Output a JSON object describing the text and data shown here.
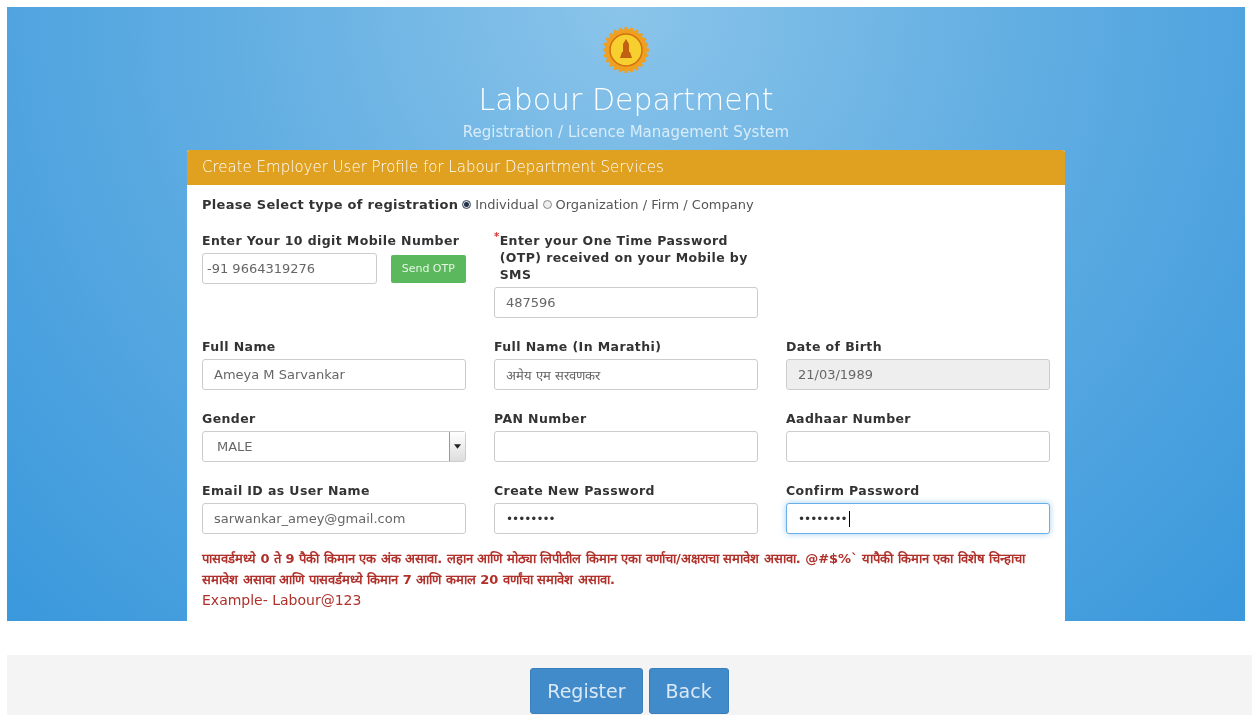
{
  "header": {
    "title": "Labour Department",
    "subtitle": "Registration / Licence Management System"
  },
  "card": {
    "title": "Create Employer User Profile for Labour Department Services",
    "registration": {
      "label": "Please Select type of registration",
      "options": [
        {
          "label": "Individual",
          "selected": true
        },
        {
          "label": "Organization / Firm / Company",
          "selected": false
        }
      ]
    },
    "rows": [
      [
        {
          "kind": "mobile",
          "label": "Enter Your 10 digit Mobile Number",
          "value": "-91  9664319276",
          "button": "Send OTP"
        },
        {
          "kind": "text",
          "label": "Enter your One Time Password (OTP) received on your Mobile by SMS",
          "marker": "*",
          "value": "487596"
        }
      ],
      [
        {
          "kind": "text",
          "label": "Full Name",
          "value": "Ameya M Sarvankar"
        },
        {
          "kind": "text",
          "label": "Full Name (In Marathi)",
          "value": "अमेय एम सरवणकर"
        },
        {
          "kind": "text",
          "label": "Date of Birth",
          "value": "21/03/1989",
          "disabled": true
        }
      ],
      [
        {
          "kind": "select",
          "label": "Gender",
          "value": "MALE"
        },
        {
          "kind": "text",
          "label": "PAN Number"
        },
        {
          "kind": "text",
          "label": "Aadhaar Number"
        }
      ],
      [
        {
          "kind": "text",
          "label": "Email ID as User Name",
          "value": "sarwankar_amey@gmail.com"
        },
        {
          "kind": "password",
          "label": "Create New Password",
          "value": "••••••••"
        },
        {
          "kind": "password",
          "label": "Confirm Password",
          "value": "••••••••",
          "focused": true
        }
      ]
    ],
    "help_text": "पासवर्डमध्ये 0 ते 9 पैकी किमान एक अंक असावा. लहान आणि मोठ्या लिपीतील किमान एका वर्णाचा/अक्षराचा समावेश असावा. @#$%` यापैकी किमान एका विशेष चिन्हाचा समावेश असावा आणि पासवर्डमध्ये किमान 7 आणि कमाल 20 वर्णांचा समावेश असावा.",
    "example": "Example- Labour@123"
  },
  "buttons": [
    "Register",
    "Back"
  ]
}
